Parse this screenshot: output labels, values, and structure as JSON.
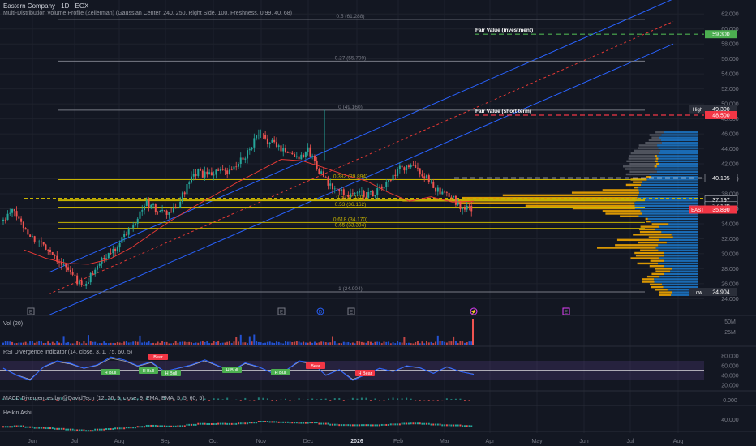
{
  "header": {
    "title": "Eastern Company · 1D · EGX",
    "subtitle": "Multi-Distribution Volume Profile (Zeiierman) (Gaussian Center, 240, 250, Right Side, 100, Freshness, 0.99, 40, 68)"
  },
  "panes": {
    "vol": "Vol (20)",
    "rsi": "RSI Divergence Indicator (14, close, 3, 1, 75, 60, 5)",
    "macd": "MACD Divergences by @DavidTech (12, 26, 9, close, 9, EMA, EMA, 5, 5, 60, 5)",
    "heikin": "Heikin Ashi"
  },
  "colors": {
    "background": "#131722",
    "grid": "#1e222d",
    "up": "#26a69a",
    "down": "#ef5350",
    "fib": "#c8b400",
    "channel": "#2962ff",
    "ma": "#e53935",
    "profile_orange": "#f0a500",
    "profile_blue": "#1e88e5",
    "profile_grey": "#787b86"
  },
  "chart_data": {
    "type": "candlestick",
    "symbol": "EAST",
    "last_price": 35.89,
    "x_ticks": [
      "Jun",
      "Jul",
      "Aug",
      "Sep",
      "Oct",
      "Nov",
      "Dec",
      "2026",
      "Feb",
      "Mar",
      "Apr",
      "May",
      "Jun",
      "Jul",
      "Aug"
    ],
    "y_ticks": [
      "62.000",
      "60.000",
      "58.000",
      "56.000",
      "54.000",
      "52.000",
      "50.000",
      "48.000",
      "46.000",
      "44.000",
      "42.000",
      "40.000",
      "38.000",
      "36.000",
      "34.000",
      "32.000",
      "30.000",
      "28.000",
      "26.000",
      "24.000"
    ],
    "ylim": [
      23.5,
      63
    ],
    "price_path": [
      34.4,
      35.8,
      33.6,
      31.9,
      31.2,
      29.8,
      28.3,
      26.8,
      25.4,
      28.2,
      29.4,
      30.8,
      32.7,
      34.5,
      36.8,
      35.9,
      35.3,
      36.0,
      38.8,
      40.9,
      40.4,
      41.1,
      40.6,
      41.8,
      43.6,
      45.8,
      45.1,
      44.3,
      43.6,
      42.9,
      43.8,
      41.2,
      39.1,
      38.3,
      37.9,
      38.2,
      37.8,
      38.6,
      39.7,
      41.3,
      41.7,
      40.9,
      39.4,
      37.9,
      37.6,
      36.2,
      35.9
    ],
    "ma_path": [
      30.5,
      29.4,
      28.7,
      28.6,
      29.3,
      30.8,
      32.8,
      34.7,
      36.4,
      38.0,
      39.6,
      41.1,
      42.6,
      42.4,
      41.5,
      40.5,
      39.7,
      38.2,
      37.0,
      37.6,
      36.9,
      37.0
    ],
    "fib_levels": [
      {
        "label": "0.5 (61.288)",
        "value": 61.288
      },
      {
        "label": "0.27 (55.709)",
        "value": 55.709
      },
      {
        "label": "0 (49.160)",
        "value": 49.16
      },
      {
        "label": "0.382 (39.894)",
        "value": 39.894
      },
      {
        "label": "0.5 (37.120)",
        "value": 37.12
      },
      {
        "label": "0.53 (36.162)",
        "value": 36.162
      },
      {
        "label": "0.618 (34.170)",
        "value": 34.17
      },
      {
        "label": "0.65 (33.394)",
        "value": 33.394
      },
      {
        "label": "1 (24.904)",
        "value": 24.904
      }
    ],
    "fair_value": [
      {
        "label": "Fair Value (investment)",
        "value": 59.3,
        "color": "#4caf50"
      },
      {
        "label": "Fair Value (short term)",
        "value": 48.5,
        "color": "#f23645"
      }
    ],
    "price_tags": [
      {
        "label": "High",
        "value": 49.3,
        "text": "49.300",
        "color": "#2a2e39"
      },
      {
        "label": "",
        "value": 48.5,
        "text": "48.500",
        "color": "#f23645"
      },
      {
        "label": "",
        "value": 59.3,
        "text": "59.300",
        "color": "#4caf50"
      },
      {
        "label": "",
        "value": 40.105,
        "text": "40.105",
        "color": "#131722"
      },
      {
        "label": "",
        "value": 37.197,
        "text": "37.197",
        "color": "#131722"
      },
      {
        "label": "",
        "value": 36.4,
        "text": "37.120",
        "color": "#131722"
      },
      {
        "label": "EAST",
        "value": 35.89,
        "text": "35.890",
        "color": "#f23645"
      },
      {
        "label": "Low",
        "value": 24.904,
        "text": "24.904",
        "color": "#2a2e39"
      }
    ],
    "vol_ticks": [
      "50M",
      "25M"
    ],
    "rsi_ticks": [
      "80.000",
      "60.000",
      "40.000",
      "20.000"
    ],
    "rsi_path": [
      55,
      40,
      30,
      58,
      70,
      65,
      55,
      62,
      78,
      72,
      60,
      68,
      48,
      55,
      62,
      72,
      60,
      50,
      66,
      58,
      45,
      50,
      70,
      66,
      40,
      52,
      30,
      42,
      55,
      48,
      60,
      56,
      44,
      58,
      48,
      42
    ],
    "rsi_labels": [
      {
        "text": "Bear",
        "kind": "bear"
      },
      {
        "text": "H Bull",
        "kind": "bull"
      },
      {
        "text": "H Bull",
        "kind": "bull"
      },
      {
        "text": "H Bull",
        "kind": "bull"
      },
      {
        "text": "H Bull",
        "kind": "bull"
      },
      {
        "text": "H Bull",
        "kind": "bull"
      },
      {
        "text": "Bear",
        "kind": "bear"
      },
      {
        "text": "H Bear",
        "kind": "bear"
      }
    ],
    "macd_ticks": [
      "0.000"
    ],
    "heikin_ticks": [
      "40.000"
    ],
    "events": [
      "E",
      "E",
      "D",
      "E",
      "⚡",
      "E"
    ]
  }
}
